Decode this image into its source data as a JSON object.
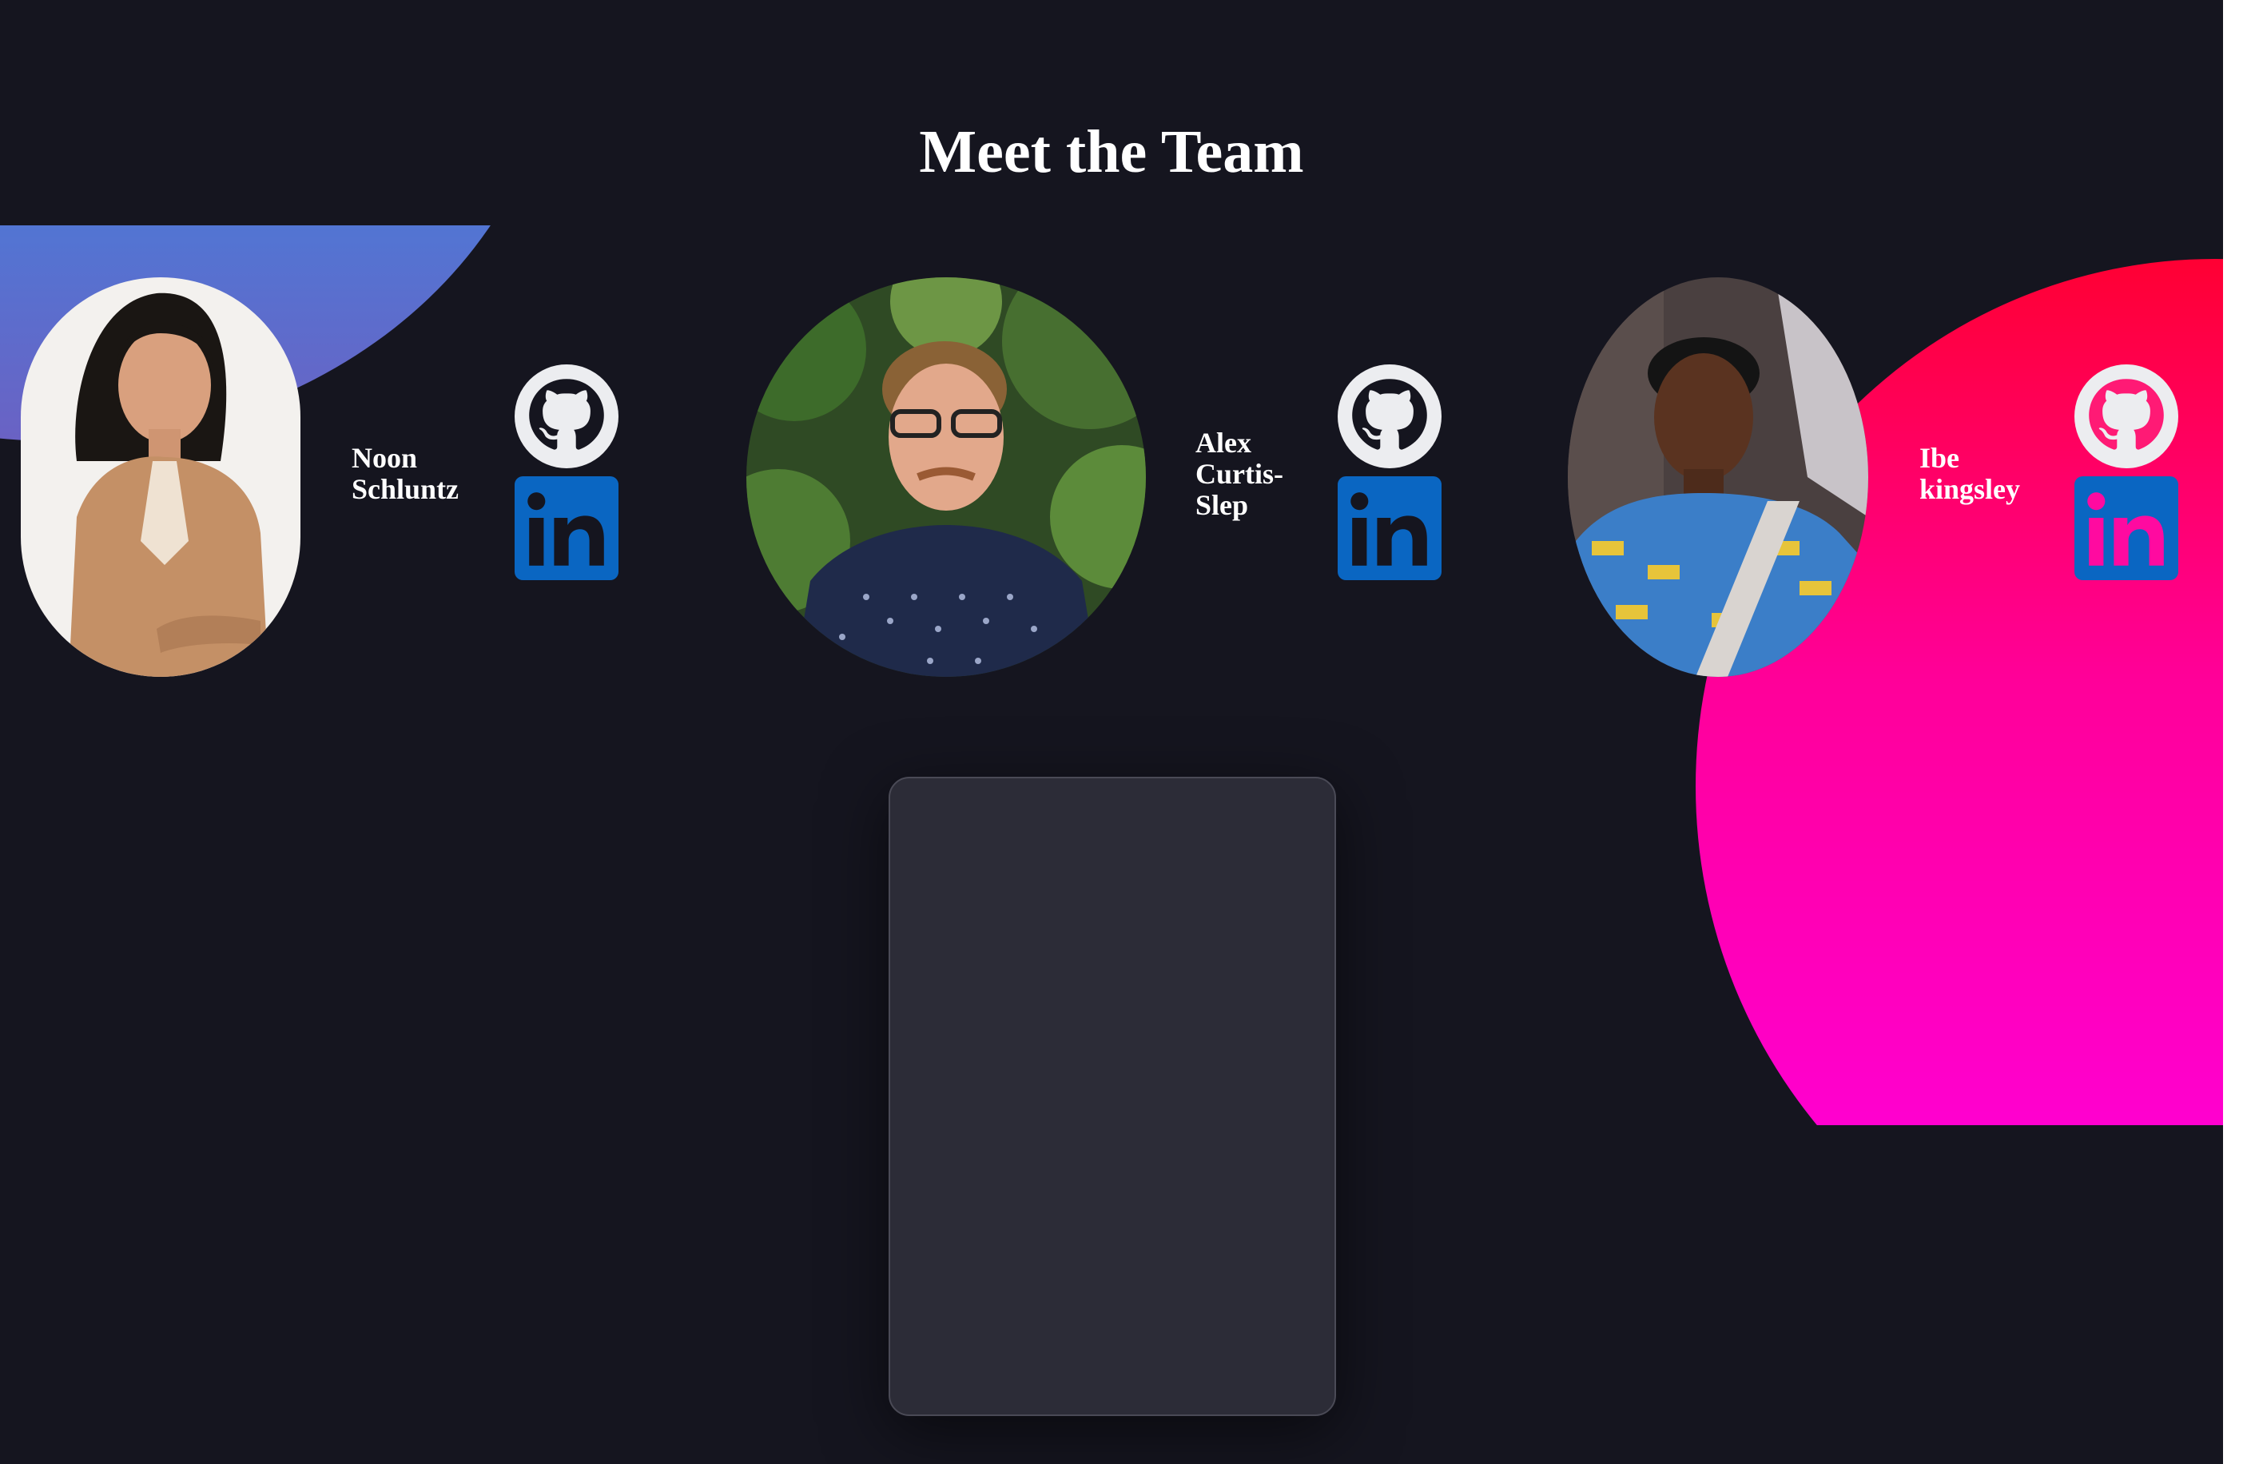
{
  "page": {
    "title": "Meet the Team"
  },
  "colors": {
    "background": "#15151f",
    "accent_blue": "#4879d6",
    "accent_pink_top": "#ff0033",
    "accent_pink_bottom": "#ff00e6",
    "linkedin": "#0a66c2",
    "card": "#2c2c37"
  },
  "team": [
    {
      "name_line1": "Noon",
      "name_line2": "Schluntz",
      "github_icon": "github-icon",
      "linkedin_icon": "linkedin-icon"
    },
    {
      "name_line1": "Alex",
      "name_line2": "Curtis-",
      "name_line3": "Slep",
      "github_icon": "github-icon",
      "linkedin_icon": "linkedin-icon"
    },
    {
      "name_line1": "Ibe",
      "name_line2": "kingsley",
      "github_icon": "github-icon",
      "linkedin_icon": "linkedin-icon"
    }
  ]
}
